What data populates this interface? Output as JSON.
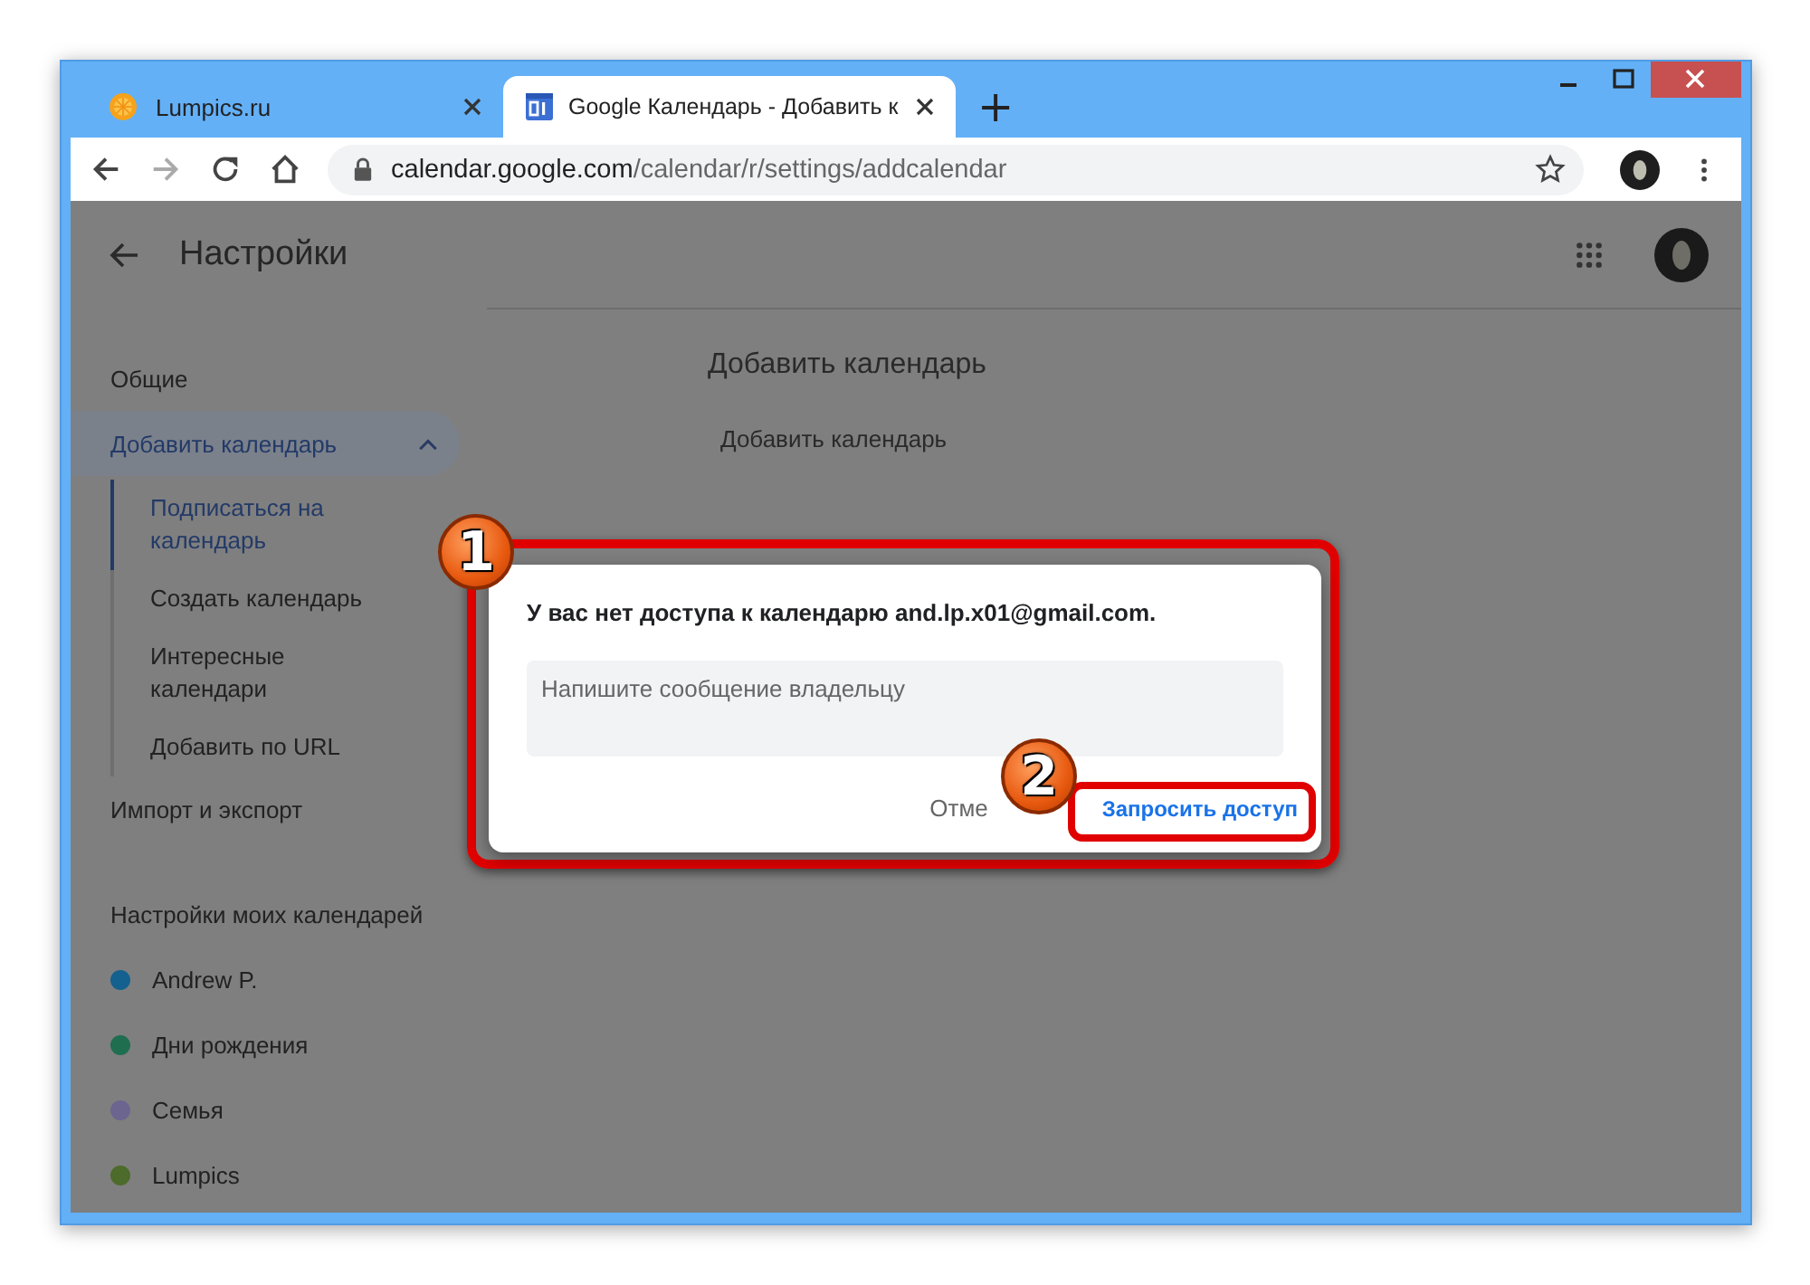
{
  "browser": {
    "tabs": [
      {
        "title": "Lumpics.ru",
        "kind": "site",
        "selected": false
      },
      {
        "title": "Google Календарь - Добавить к",
        "kind": "calendar",
        "selected": true
      }
    ],
    "new_tab": "+",
    "url": {
      "domain": "calendar.google.com",
      "path": "/calendar/r/settings/addcalendar"
    }
  },
  "header": {
    "title": "Настройки"
  },
  "sidebar": {
    "items": [
      {
        "label": "Общие",
        "selected": false
      },
      {
        "label": "Добавить календарь",
        "selected": true,
        "expanded": true,
        "children": [
          {
            "label": "Подписаться на календарь",
            "selected": true
          },
          {
            "label": "Создать календарь",
            "selected": false
          },
          {
            "label": "Интересные календари",
            "selected": false
          },
          {
            "label": "Добавить по URL",
            "selected": false
          }
        ]
      },
      {
        "label": "Импорт и экспорт",
        "selected": false
      }
    ],
    "my_calendars": {
      "title": "Настройки моих календарей",
      "items": [
        {
          "name": "Andrew P.",
          "color": "#14608f"
        },
        {
          "name": "Дни рождения",
          "color": "#1f6e4f"
        },
        {
          "name": "Семья",
          "color": "#6c6590"
        },
        {
          "name": "Lumpics",
          "color": "#4d6b2b"
        }
      ]
    }
  },
  "main": {
    "heading": "Добавить календарь",
    "subheading": "Добавить календарь"
  },
  "dialog": {
    "message": "У вас нет доступа к календарю and.lp.x01@gmail.com.",
    "message_field": {
      "placeholder": "Напишите сообщение владельцу"
    },
    "buttons": [
      {
        "label": "Отме",
        "kind": "text"
      },
      {
        "label": "Запросить доступ",
        "kind": "primary"
      }
    ]
  },
  "annotations": [
    {
      "number": "1"
    },
    {
      "number": "2"
    }
  ]
}
